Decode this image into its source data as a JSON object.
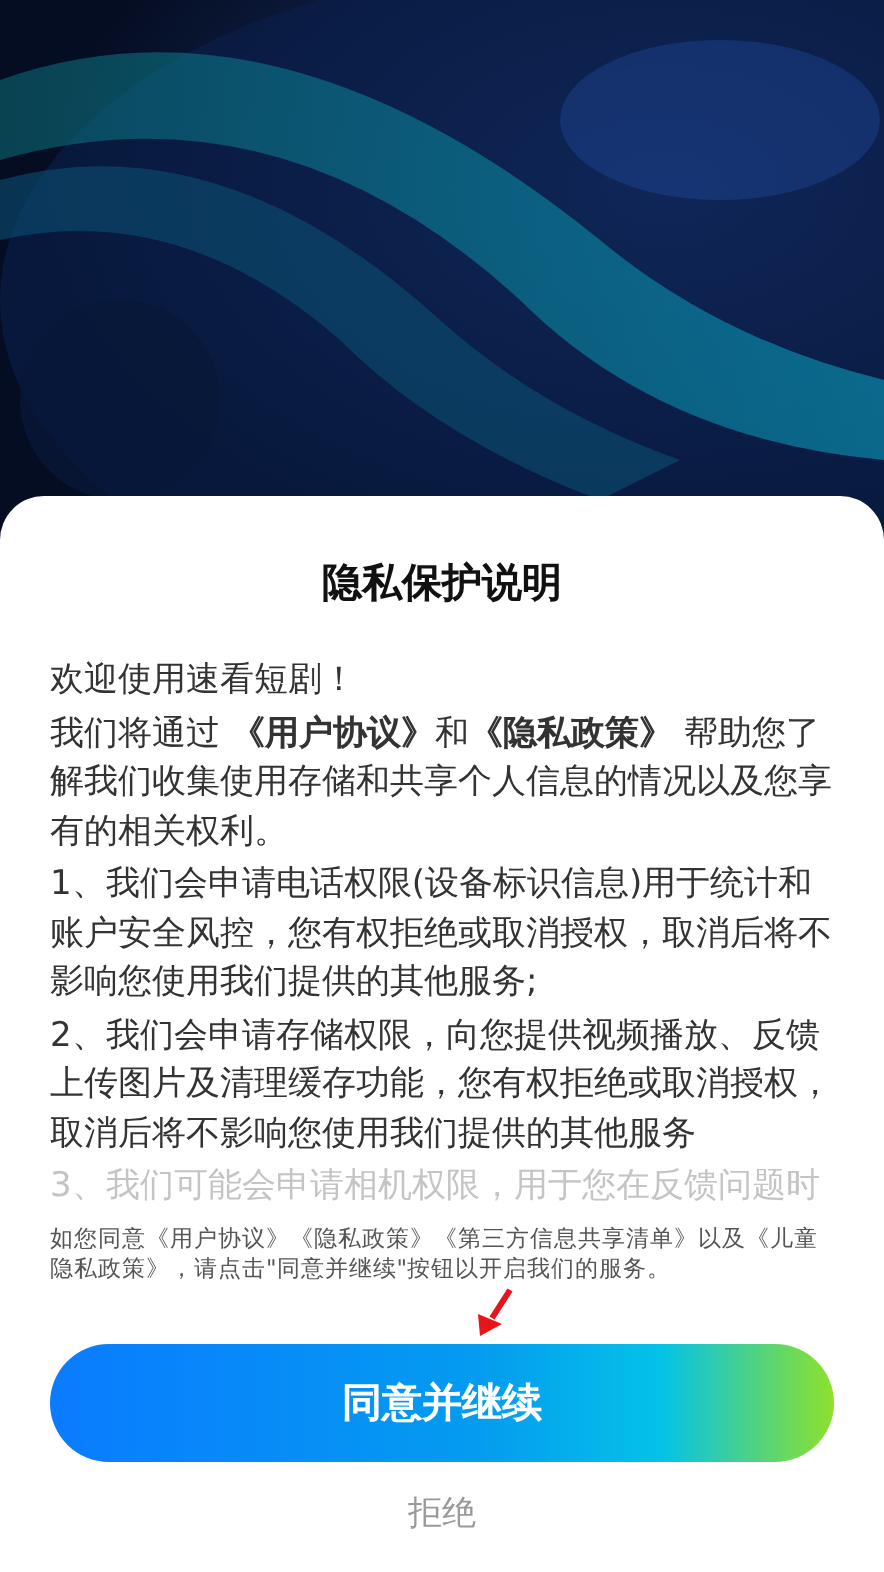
{
  "dialog": {
    "title": "隐私保护说明",
    "paragraphs": [
      {
        "text": "欢迎使用速看短剧！",
        "faded": false
      },
      {
        "text": "我们将通过 **《用户协议》**和**《隐私政策》** 帮助您了解我们收集使用存储和共享个人信息的情况以及您享有的相关权利。",
        "faded": false
      },
      {
        "text": "1、我们会申请电话权限(设备标识信息)用于统计和账户安全风控，您有权拒绝或取消授权，取消后将不影响您使用我们提供的其他服务;",
        "faded": false
      },
      {
        "text": "2、我们会申请存储权限，向您提供视频播放、反馈上传图片及清理缓存功能，您有权拒绝或取消授权，取消后将不影响您使用我们提供的其他服务",
        "faded": false
      },
      {
        "text": "3、我们可能会申请相机权限，用于您在反馈问题时",
        "faded": true
      }
    ],
    "notice": "如您同意《用户协议》《隐私政策》《第三方信息共享清单》以及《儿童隐私政策》，请点击\"同意并继续\"按钮以开启我们的服务。",
    "buttons": [
      {
        "label": "同意并继续",
        "kind": "primary"
      },
      {
        "label": "拒绝",
        "kind": "text"
      }
    ]
  },
  "annotation": {
    "kind": "arrow"
  }
}
